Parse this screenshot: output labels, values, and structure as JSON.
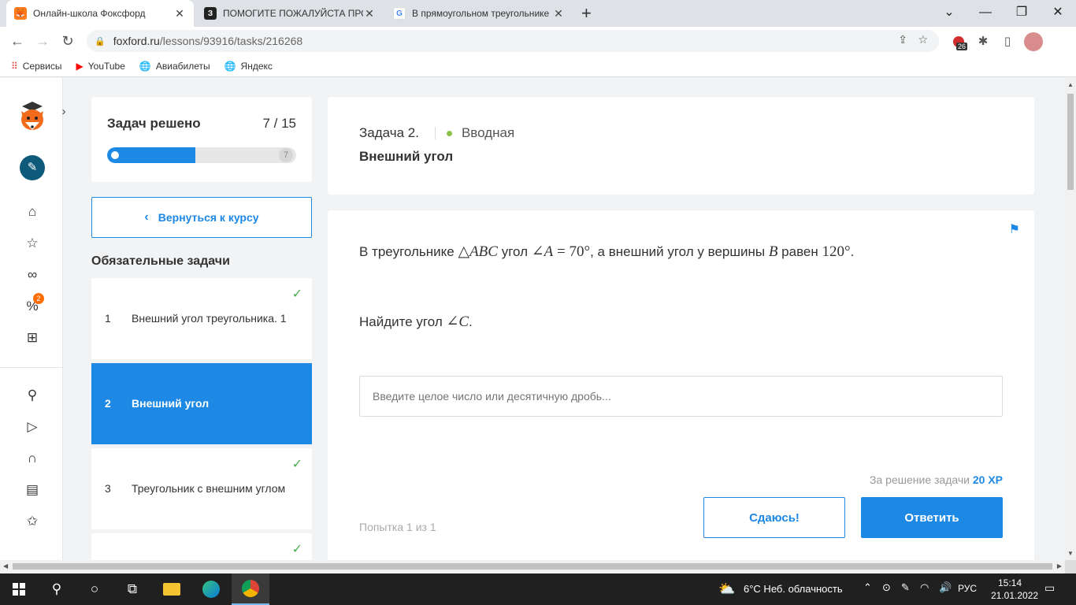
{
  "browser": {
    "tabs": [
      {
        "title": "Онлайн-школа Фоксфорд",
        "active": true
      },
      {
        "title": "ПОМОГИТЕ ПОЖАЛУЙСТА ПРОШ",
        "active": false
      },
      {
        "title": "В прямоугольном треугольнике",
        "active": false
      }
    ],
    "url_host": "foxford.ru",
    "url_path": "/lessons/93916/tasks/216268",
    "extension_badge": "26",
    "bookmarks": [
      "Сервисы",
      "YouTube",
      "Авиабилеты",
      "Яндекс"
    ]
  },
  "sidebar": {
    "notification_badge": "2"
  },
  "progress": {
    "title": "Задач решено",
    "count": "7 / 15",
    "solved": 7,
    "total": 15,
    "bar_end_label": "7"
  },
  "back_button": "Вернуться к курсу",
  "section_title": "Обязательные задачи",
  "tasks": [
    {
      "num": "1",
      "label": "Внешний угол треугольника. 1",
      "done": true
    },
    {
      "num": "2",
      "label": "Внешний угол",
      "done": false,
      "active": true
    },
    {
      "num": "3",
      "label": "Треугольник с внешним углом",
      "done": true
    }
  ],
  "task": {
    "number": "Задача 2.",
    "level": "Вводная",
    "title": "Внешний угол",
    "statement_parts": {
      "p1": "В треугольнике ",
      "tri": "△",
      "abc": "ABC",
      "p2": " угол ",
      "angle": "∠",
      "a": "A",
      "eq": " = 70°",
      "p3": ", а внешний угол у вершины ",
      "b": "B",
      "p4": " равен ",
      "val": "120°",
      "p5": "."
    },
    "question_parts": {
      "q1": "Найдите угол ",
      "angle": "∠",
      "c": "C",
      "q2": "."
    },
    "answer_placeholder": "Введите целое число или десятичную дробь...",
    "reward_text": "За решение задачи",
    "reward_xp": "20 XP",
    "attempt": "Попытка 1 из 1",
    "giveup_button": "Сдаюсь!",
    "answer_button": "Ответить"
  },
  "taskbar": {
    "weather": "6°C  Неб. облачность",
    "lang": "РУС",
    "time": "15:14",
    "date": "21.01.2022"
  },
  "colors": {
    "accent": "#1e88e5",
    "success": "#4caf50",
    "level_dot": "#8bc34a"
  }
}
